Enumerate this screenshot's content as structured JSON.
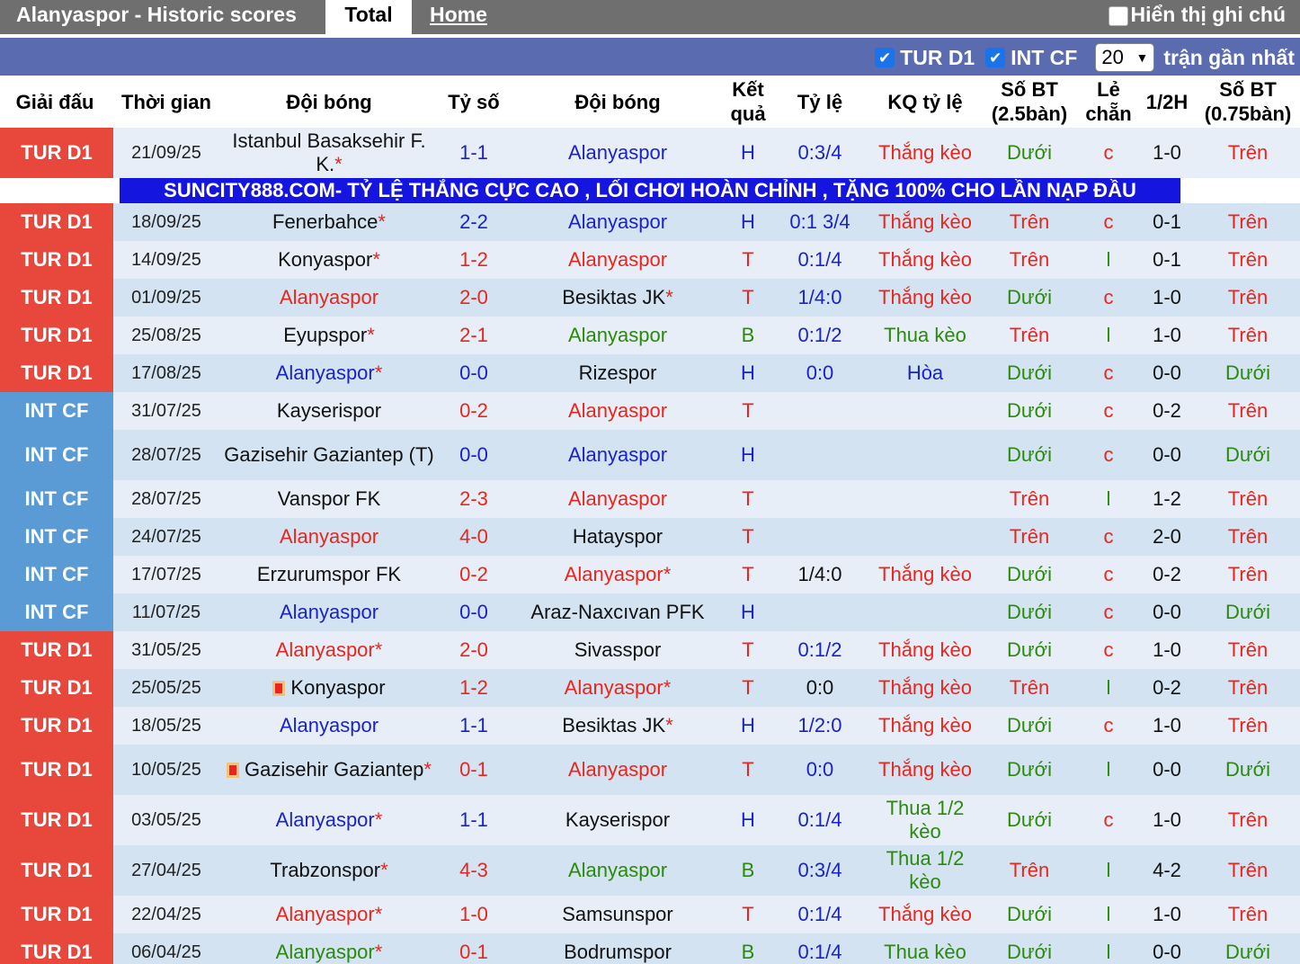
{
  "header": {
    "title": "Alanyaspor - Historic scores",
    "tab_total": "Total",
    "tab_home": "Home",
    "show_notes": "Hiển thị ghi chú"
  },
  "filters": {
    "league1": "TUR D1",
    "league2": "INT CF",
    "count": "20",
    "suffix": "trận gần nhất"
  },
  "columns": [
    "Giải đấu",
    "Thời gian",
    "Đội bóng",
    "Tỷ số",
    "Đội bóng",
    "Kết quả",
    "Tỷ lệ",
    "KQ tỷ lệ",
    "Số BT (2.5bàn)",
    "Lẻ chẵn",
    "1/2H",
    "Số BT (0.75bàn)"
  ],
  "banner": "SUNCITY888.COM- TỶ LỆ THẮNG CỰC CAO , LỐI CHƠI HOÀN CHỈNH , TẶNG 100% CHO LẦN NẠP ĐẦU",
  "colors": {
    "red": "#e8261d",
    "blue": "#1a23c8",
    "green": "#2a8a0b",
    "tur_bg": "#e8473c",
    "int_bg": "#5b9bd5"
  },
  "matches": [
    {
      "league": "TUR D1",
      "date": "21/09/25",
      "home": "Istanbul Basaksehir F. K.",
      "home_star": "*",
      "home_color": "black",
      "score": "1-1",
      "score_color": "blue",
      "away": "Alanyaspor",
      "away_star": "",
      "away_color": "blue",
      "result": "H",
      "result_color": "blue",
      "odds": "0:3/4",
      "odds_color": "blue",
      "kq": "Thắng kèo",
      "kq_color": "red",
      "ou": "Dưới",
      "ou_color": "green",
      "le": "c",
      "le_color": "red",
      "ht": "1-0",
      "ou2": "Trên",
      "ou2_color": "red"
    },
    {
      "league": "TUR D1",
      "date": "18/09/25",
      "home": "Fenerbahce",
      "home_star": "*",
      "home_color": "black",
      "score": "2-2",
      "score_color": "blue",
      "away": "Alanyaspor",
      "away_star": "",
      "away_color": "blue",
      "result": "H",
      "result_color": "blue",
      "odds": "0:1 3/4",
      "odds_color": "blue",
      "kq": "Thắng kèo",
      "kq_color": "red",
      "ou": "Trên",
      "ou_color": "red",
      "le": "c",
      "le_color": "red",
      "ht": "0-1",
      "ou2": "Trên",
      "ou2_color": "red"
    },
    {
      "league": "TUR D1",
      "date": "14/09/25",
      "home": "Konyaspor",
      "home_star": "*",
      "home_color": "black",
      "score": "1-2",
      "score_color": "red",
      "away": "Alanyaspor",
      "away_star": "",
      "away_color": "red",
      "result": "T",
      "result_color": "red",
      "odds": "0:1/4",
      "odds_color": "blue",
      "kq": "Thắng kèo",
      "kq_color": "red",
      "ou": "Trên",
      "ou_color": "red",
      "le": "l",
      "le_color": "green",
      "ht": "0-1",
      "ou2": "Trên",
      "ou2_color": "red"
    },
    {
      "league": "TUR D1",
      "date": "01/09/25",
      "home": "Alanyaspor",
      "home_star": "",
      "home_color": "red",
      "score": "2-0",
      "score_color": "red",
      "away": "Besiktas JK",
      "away_star": "*",
      "away_color": "black",
      "result": "T",
      "result_color": "red",
      "odds": "1/4:0",
      "odds_color": "blue",
      "kq": "Thắng kèo",
      "kq_color": "red",
      "ou": "Dưới",
      "ou_color": "green",
      "le": "c",
      "le_color": "red",
      "ht": "1-0",
      "ou2": "Trên",
      "ou2_color": "red"
    },
    {
      "league": "TUR D1",
      "date": "25/08/25",
      "home": "Eyupspor",
      "home_star": "*",
      "home_color": "black",
      "score": "2-1",
      "score_color": "red",
      "away": "Alanyaspor",
      "away_star": "",
      "away_color": "green",
      "result": "B",
      "result_color": "green",
      "odds": "0:1/2",
      "odds_color": "blue",
      "kq": "Thua kèo",
      "kq_color": "green",
      "ou": "Trên",
      "ou_color": "red",
      "le": "l",
      "le_color": "green",
      "ht": "1-0",
      "ou2": "Trên",
      "ou2_color": "red"
    },
    {
      "league": "TUR D1",
      "date": "17/08/25",
      "home": "Alanyaspor",
      "home_star": "*",
      "home_color": "blue",
      "score": "0-0",
      "score_color": "blue",
      "away": "Rizespor",
      "away_star": "",
      "away_color": "black",
      "result": "H",
      "result_color": "blue",
      "odds": "0:0",
      "odds_color": "blue",
      "kq": "Hòa",
      "kq_color": "blue",
      "ou": "Dưới",
      "ou_color": "green",
      "le": "c",
      "le_color": "red",
      "ht": "0-0",
      "ou2": "Dưới",
      "ou2_color": "green"
    },
    {
      "league": "INT CF",
      "date": "31/07/25",
      "home": "Kayserispor",
      "home_star": "",
      "home_color": "black",
      "score": "0-2",
      "score_color": "red",
      "away": "Alanyaspor",
      "away_star": "",
      "away_color": "red",
      "result": "T",
      "result_color": "red",
      "odds": "",
      "odds_color": "blue",
      "kq": "",
      "kq_color": "red",
      "ou": "Dưới",
      "ou_color": "green",
      "le": "c",
      "le_color": "red",
      "ht": "0-2",
      "ou2": "Trên",
      "ou2_color": "red"
    },
    {
      "league": "INT CF",
      "date": "28/07/25",
      "home": "Gazisehir Gaziantep (T)",
      "home_star": "",
      "home_color": "black",
      "score": "0-0",
      "score_color": "blue",
      "away": "Alanyaspor",
      "away_star": "",
      "away_color": "blue",
      "result": "H",
      "result_color": "blue",
      "odds": "",
      "odds_color": "blue",
      "kq": "",
      "kq_color": "red",
      "ou": "Dưới",
      "ou_color": "green",
      "le": "c",
      "le_color": "red",
      "ht": "0-0",
      "ou2": "Dưới",
      "ou2_color": "green"
    },
    {
      "league": "INT CF",
      "date": "28/07/25",
      "home": "Vanspor FK",
      "home_star": "",
      "home_color": "black",
      "score": "2-3",
      "score_color": "red",
      "away": "Alanyaspor",
      "away_star": "",
      "away_color": "red",
      "result": "T",
      "result_color": "red",
      "odds": "",
      "odds_color": "blue",
      "kq": "",
      "kq_color": "red",
      "ou": "Trên",
      "ou_color": "red",
      "le": "l",
      "le_color": "green",
      "ht": "1-2",
      "ou2": "Trên",
      "ou2_color": "red"
    },
    {
      "league": "INT CF",
      "date": "24/07/25",
      "home": "Alanyaspor",
      "home_star": "",
      "home_color": "red",
      "score": "4-0",
      "score_color": "red",
      "away": "Hatayspor",
      "away_star": "",
      "away_color": "black",
      "result": "T",
      "result_color": "red",
      "odds": "",
      "odds_color": "blue",
      "kq": "",
      "kq_color": "red",
      "ou": "Trên",
      "ou_color": "red",
      "le": "c",
      "le_color": "red",
      "ht": "2-0",
      "ou2": "Trên",
      "ou2_color": "red"
    },
    {
      "league": "INT CF",
      "date": "17/07/25",
      "home": "Erzurumspor FK",
      "home_star": "",
      "home_color": "black",
      "score": "0-2",
      "score_color": "red",
      "away": "Alanyaspor",
      "away_star": "*",
      "away_color": "red",
      "result": "T",
      "result_color": "red",
      "odds": "1/4:0",
      "odds_color": "black",
      "kq": "Thắng kèo",
      "kq_color": "red",
      "ou": "Dưới",
      "ou_color": "green",
      "le": "c",
      "le_color": "red",
      "ht": "0-2",
      "ou2": "Trên",
      "ou2_color": "red"
    },
    {
      "league": "INT CF",
      "date": "11/07/25",
      "home": "Alanyaspor",
      "home_star": "",
      "home_color": "blue",
      "score": "0-0",
      "score_color": "blue",
      "away": "Araz-Naxcıvan PFK",
      "away_star": "",
      "away_color": "black",
      "result": "H",
      "result_color": "blue",
      "odds": "",
      "odds_color": "blue",
      "kq": "",
      "kq_color": "red",
      "ou": "Dưới",
      "ou_color": "green",
      "le": "c",
      "le_color": "red",
      "ht": "0-0",
      "ou2": "Dưới",
      "ou2_color": "green"
    },
    {
      "league": "TUR D1",
      "date": "31/05/25",
      "home": "Alanyaspor",
      "home_star": "*",
      "home_color": "red",
      "score": "2-0",
      "score_color": "red",
      "away": "Sivasspor",
      "away_star": "",
      "away_color": "black",
      "result": "T",
      "result_color": "red",
      "odds": "0:1/2",
      "odds_color": "blue",
      "kq": "Thắng kèo",
      "kq_color": "red",
      "ou": "Dưới",
      "ou_color": "green",
      "le": "c",
      "le_color": "red",
      "ht": "1-0",
      "ou2": "Trên",
      "ou2_color": "red"
    },
    {
      "league": "TUR D1",
      "date": "25/05/25",
      "home": "Konyaspor",
      "home_star": "",
      "home_color": "black",
      "home_flag": true,
      "score": "1-2",
      "score_color": "red",
      "away": "Alanyaspor",
      "away_star": "*",
      "away_color": "red",
      "result": "T",
      "result_color": "red",
      "odds": "0:0",
      "odds_color": "black",
      "kq": "Thắng kèo",
      "kq_color": "red",
      "ou": "Trên",
      "ou_color": "red",
      "le": "l",
      "le_color": "green",
      "ht": "0-2",
      "ou2": "Trên",
      "ou2_color": "red"
    },
    {
      "league": "TUR D1",
      "date": "18/05/25",
      "home": "Alanyaspor",
      "home_star": "",
      "home_color": "blue",
      "score": "1-1",
      "score_color": "blue",
      "away": "Besiktas JK",
      "away_star": "*",
      "away_color": "black",
      "result": "H",
      "result_color": "blue",
      "odds": "1/2:0",
      "odds_color": "blue",
      "kq": "Thắng kèo",
      "kq_color": "red",
      "ou": "Dưới",
      "ou_color": "green",
      "le": "c",
      "le_color": "red",
      "ht": "1-0",
      "ou2": "Trên",
      "ou2_color": "red"
    },
    {
      "league": "TUR D1",
      "date": "10/05/25",
      "home": "Gazisehir Gaziantep",
      "home_star": "*",
      "home_color": "black",
      "home_flag": true,
      "score": "0-1",
      "score_color": "red",
      "away": "Alanyaspor",
      "away_star": "",
      "away_color": "red",
      "result": "T",
      "result_color": "red",
      "odds": "0:0",
      "odds_color": "blue",
      "kq": "Thắng kèo",
      "kq_color": "red",
      "ou": "Dưới",
      "ou_color": "green",
      "le": "l",
      "le_color": "green",
      "ht": "0-0",
      "ou2": "Dưới",
      "ou2_color": "green"
    },
    {
      "league": "TUR D1",
      "date": "03/05/25",
      "home": "Alanyaspor",
      "home_star": "*",
      "home_color": "blue",
      "score": "1-1",
      "score_color": "blue",
      "away": "Kayserispor",
      "away_star": "",
      "away_color": "black",
      "result": "H",
      "result_color": "blue",
      "odds": "0:1/4",
      "odds_color": "blue",
      "kq": "Thua 1/2 kèo",
      "kq_color": "green",
      "ou": "Dưới",
      "ou_color": "green",
      "le": "c",
      "le_color": "red",
      "ht": "1-0",
      "ou2": "Trên",
      "ou2_color": "red"
    },
    {
      "league": "TUR D1",
      "date": "27/04/25",
      "home": "Trabzonspor",
      "home_star": "*",
      "home_color": "black",
      "score": "4-3",
      "score_color": "red",
      "away": "Alanyaspor",
      "away_star": "",
      "away_color": "green",
      "result": "B",
      "result_color": "green",
      "odds": "0:3/4",
      "odds_color": "blue",
      "kq": "Thua 1/2 kèo",
      "kq_color": "green",
      "ou": "Trên",
      "ou_color": "red",
      "le": "l",
      "le_color": "green",
      "ht": "4-2",
      "ou2": "Trên",
      "ou2_color": "red"
    },
    {
      "league": "TUR D1",
      "date": "22/04/25",
      "home": "Alanyaspor",
      "home_star": "*",
      "home_color": "red",
      "score": "1-0",
      "score_color": "red",
      "away": "Samsunspor",
      "away_star": "",
      "away_color": "black",
      "result": "T",
      "result_color": "red",
      "odds": "0:1/4",
      "odds_color": "blue",
      "kq": "Thắng kèo",
      "kq_color": "red",
      "ou": "Dưới",
      "ou_color": "green",
      "le": "l",
      "le_color": "green",
      "ht": "1-0",
      "ou2": "Trên",
      "ou2_color": "red"
    },
    {
      "league": "TUR D1",
      "date": "06/04/25",
      "home": "Alanyaspor",
      "home_star": "*",
      "home_color": "green",
      "score": "0-1",
      "score_color": "red",
      "away": "Bodrumspor",
      "away_star": "",
      "away_color": "black",
      "result": "B",
      "result_color": "green",
      "odds": "0:1/4",
      "odds_color": "blue",
      "kq": "Thua kèo",
      "kq_color": "green",
      "ou": "Dưới",
      "ou_color": "green",
      "le": "l",
      "le_color": "green",
      "ht": "0-0",
      "ou2": "Dưới",
      "ou2_color": "green"
    }
  ]
}
